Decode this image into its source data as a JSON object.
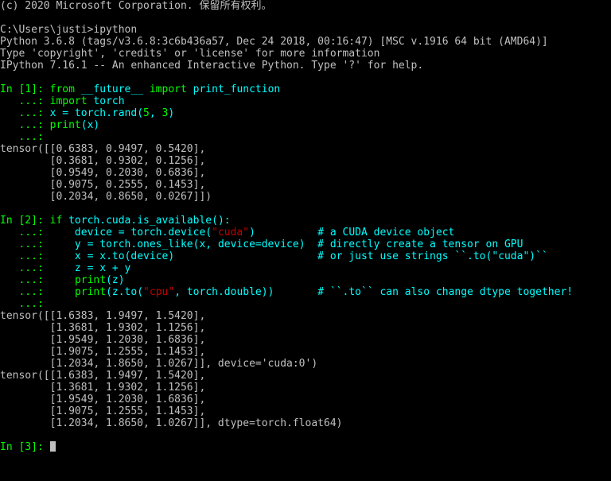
{
  "copyright": "(c) 2020 Microsoft Corporation. 保留所有权利。",
  "blank": "",
  "prompt_path": "C:\\Users\\justi>",
  "cmd": "ipython",
  "py_header1": "Python 3.6.8 (tags/v3.6.8:3c6b436a57, Dec 24 2018, 00:16:47) [MSC v.1916 64 bit (AMD64)]",
  "py_header2": "Type 'copyright', 'credits' or 'license' for more information",
  "py_header3": "IPython 7.16.1 -- An enhanced Interactive Python. Type '?' for help.",
  "in1_label": "In [1]: ",
  "cont_label": "   ...: ",
  "in1_l1a": "from",
  "in1_l1b": " __future__ ",
  "in1_l1c": "import",
  "in1_l1d": " print_function",
  "in1_l2a": "import",
  "in1_l2b": " torch",
  "in1_l3a": "x = torch.rand(",
  "in1_l3b": "5",
  "in1_l3c": ", ",
  "in1_l3d": "3",
  "in1_l3e": ")",
  "in1_l4a": "print",
  "in1_l4b": "(x)",
  "out1_l1": "tensor([[0.6383, 0.9497, 0.5420],",
  "out1_l2": "        [0.3681, 0.9302, 0.1256],",
  "out1_l3": "        [0.9549, 0.2030, 0.6836],",
  "out1_l4": "        [0.9075, 0.2555, 0.1453],",
  "out1_l5": "        [0.2034, 0.8650, 0.0267]])",
  "in2_label": "In [2]: ",
  "in2_l1a": "if",
  "in2_l1b": " torch.cuda.is_available():",
  "in2_l2a": "    device = torch.device(",
  "in2_l2b": "\"cuda\"",
  "in2_l2c": ")          ",
  "in2_l2d": "# a CUDA device object",
  "in2_l3a": "    y = torch.ones_like(x, device=device)  ",
  "in2_l3b": "# directly create a tensor on GPU",
  "in2_l4a": "    x = x.to(device)                       ",
  "in2_l4b": "# or just use strings ``.to(\"cuda\")``",
  "in2_l5": "    z = x + y",
  "in2_l6a": "    ",
  "in2_l6b": "print",
  "in2_l6c": "(z)",
  "in2_l7a": "    ",
  "in2_l7b": "print",
  "in2_l7c": "(z.to(",
  "in2_l7d": "\"cpu\"",
  "in2_l7e": ", torch.double))       ",
  "in2_l7f": "# ``.to`` can also change dtype together!",
  "out2_l1": "tensor([[1.6383, 1.9497, 1.5420],",
  "out2_l2": "        [1.3681, 1.9302, 1.1256],",
  "out2_l3": "        [1.9549, 1.2030, 1.6836],",
  "out2_l4": "        [1.9075, 1.2555, 1.1453],",
  "out2_l5": "        [1.2034, 1.8650, 1.0267]], device='cuda:0')",
  "out3_l1": "tensor([[1.6383, 1.9497, 1.5420],",
  "out3_l2": "        [1.3681, 1.9302, 1.1256],",
  "out3_l3": "        [1.9549, 1.2030, 1.6836],",
  "out3_l4": "        [1.9075, 1.2555, 1.1453],",
  "out3_l5": "        [1.2034, 1.8650, 1.0267]], dtype=torch.float64)",
  "in3_label": "In [3]: "
}
